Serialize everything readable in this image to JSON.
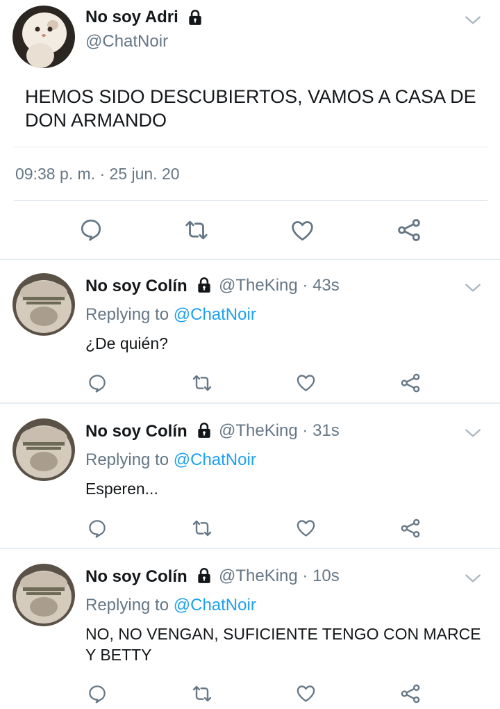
{
  "main_tweet": {
    "author_name": "No soy Adri",
    "author_handle": "@ChatNoir",
    "text": "HEMOS SIDO DESCUBIERTOS, VAMOS A CASA DE DON ARMANDO",
    "timestamp": "09:38 p. m. · 25 jun. 20"
  },
  "replies": [
    {
      "author_name": "No soy Colín",
      "meta": "@TheKing · 43s",
      "replying_label": "Replying to ",
      "replying_mention": "@ChatNoir",
      "text": "¿De quién?"
    },
    {
      "author_name": "No soy Colín",
      "meta": "@TheKing · 31s",
      "replying_label": "Replying to ",
      "replying_mention": "@ChatNoir",
      "text": "Esperen..."
    },
    {
      "author_name": "No soy Colín",
      "meta": "@TheKing · 10s",
      "replying_label": "Replying to ",
      "replying_mention": "@ChatNoir",
      "text": "NO, NO VENGAN, SUFICIENTE TENGO CON MARCE Y BETTY"
    }
  ],
  "colors": {
    "text": "#14171a",
    "secondary": "#657786",
    "mention": "#1da1f2",
    "icon": "#657786",
    "separator": "#e6ecf0"
  },
  "icons": [
    "lock-icon",
    "chevron-down-icon",
    "reply-icon",
    "retweet-icon",
    "like-icon",
    "share-icon"
  ]
}
